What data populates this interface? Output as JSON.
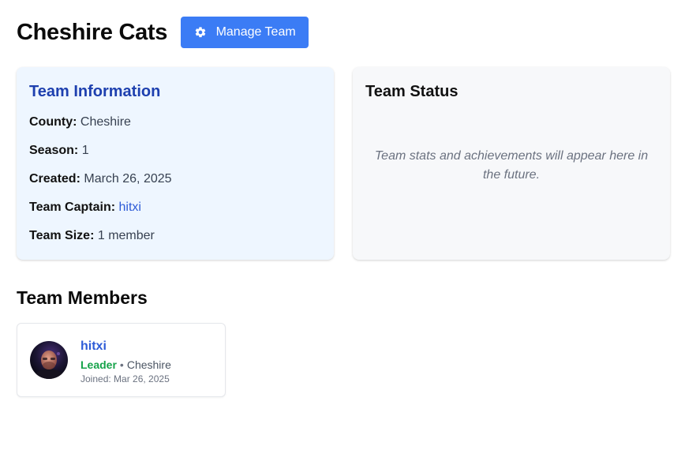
{
  "header": {
    "team_name": "Cheshire Cats",
    "manage_button_label": "Manage Team"
  },
  "team_info": {
    "title": "Team Information",
    "rows": [
      {
        "label": "County:",
        "value": "Cheshire"
      },
      {
        "label": "Season:",
        "value": "1"
      },
      {
        "label": "Created:",
        "value": "March 26, 2025"
      },
      {
        "label": "Team Captain:",
        "value": "hitxi"
      },
      {
        "label": "Team Size:",
        "value": "1 member"
      }
    ]
  },
  "team_status": {
    "title": "Team Status",
    "message": "Team stats and achievements will appear here in the future."
  },
  "members": {
    "title": "Team Members",
    "items": [
      {
        "name": "hitxi",
        "role": "Leader",
        "separator": "•",
        "county": "Cheshire",
        "joined": "Joined: Mar 26, 2025"
      }
    ]
  },
  "colors": {
    "accent": "#3b7cf5",
    "link": "#2d5bd7",
    "info_title": "#1e40af",
    "leader": "#16a34a"
  },
  "icons": {
    "manage_button": "gear-icon",
    "member_avatar": "avatar"
  }
}
